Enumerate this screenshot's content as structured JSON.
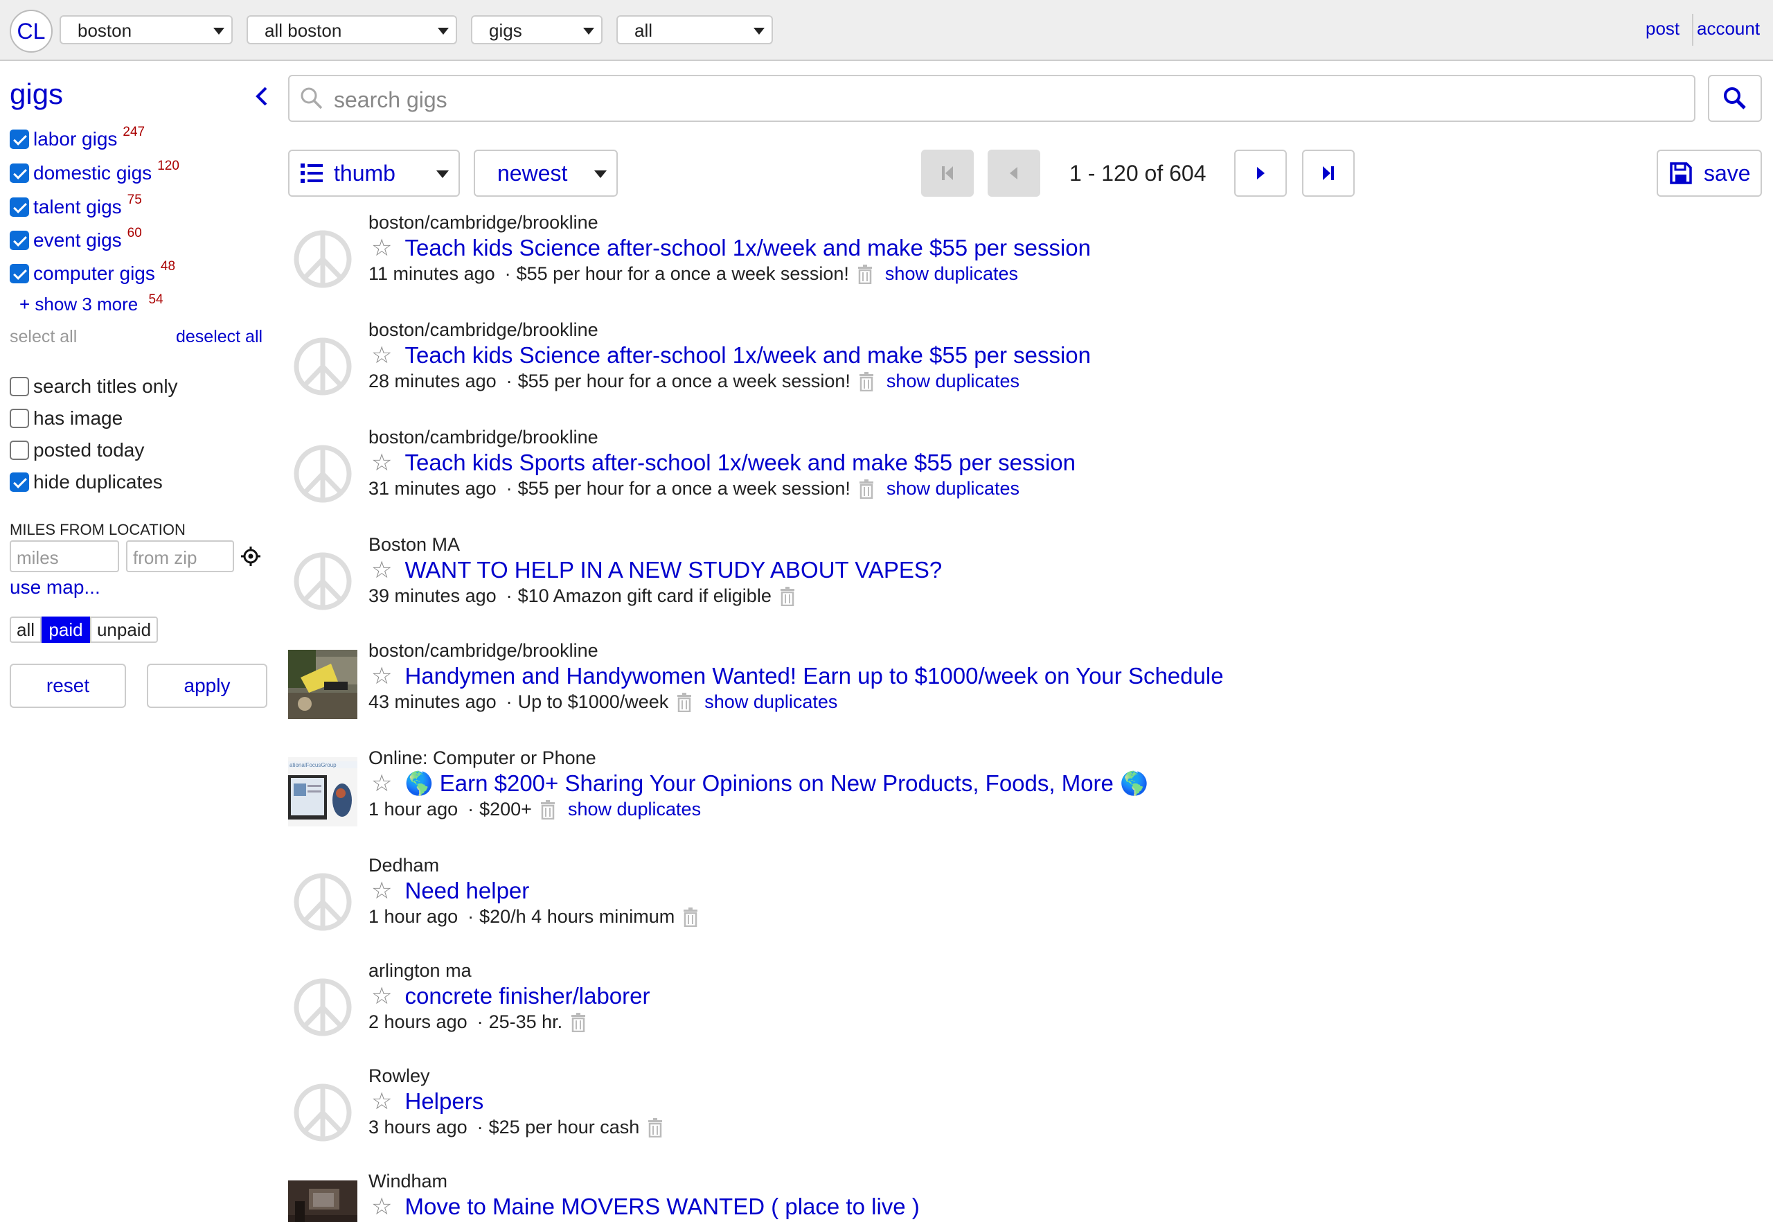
{
  "topbar": {
    "logo": "CL",
    "selects": [
      {
        "name": "site-select",
        "value": "boston"
      },
      {
        "name": "area-select",
        "value": "all boston"
      },
      {
        "name": "category-select",
        "value": "gigs"
      },
      {
        "name": "subcategory-select",
        "value": "all"
      }
    ],
    "post_label": "post",
    "account_label": "account"
  },
  "sidebar": {
    "title": "gigs",
    "categories": [
      {
        "label": "labor gigs",
        "count": "247",
        "checked": true
      },
      {
        "label": "domestic gigs",
        "count": "120",
        "checked": true
      },
      {
        "label": "talent gigs",
        "count": "75",
        "checked": true
      },
      {
        "label": "event gigs",
        "count": "60",
        "checked": true
      },
      {
        "label": "computer gigs",
        "count": "48",
        "checked": true
      }
    ],
    "show_more": {
      "label": "+  show 3 more",
      "count": "54"
    },
    "select_all": "select all",
    "deselect_all": "deselect all",
    "options": [
      {
        "label": "search titles only",
        "checked": false
      },
      {
        "label": "has image",
        "checked": false
      },
      {
        "label": "posted today",
        "checked": false
      },
      {
        "label": "hide duplicates",
        "checked": true
      }
    ],
    "miles_label": "MILES FROM LOCATION",
    "miles_placeholder": "miles",
    "zip_placeholder": "from zip",
    "use_map": "use map...",
    "pay_filter": {
      "options": [
        "all",
        "paid",
        "unpaid"
      ],
      "selected": "paid"
    },
    "reset_label": "reset",
    "apply_label": "apply"
  },
  "search": {
    "placeholder": "search gigs"
  },
  "toolbar": {
    "view_label": "thumb",
    "sort_label": "newest",
    "range": "1 - 120 of 604",
    "save_label": "save"
  },
  "results": [
    {
      "location": "boston/cambridge/brookline",
      "title": "Teach kids Science after-school 1x/week and make $55 per session",
      "time": "11 minutes ago",
      "pay": "$55 per hour for a once a week session!",
      "dupes": "show duplicates",
      "thumb": "peace"
    },
    {
      "location": "boston/cambridge/brookline",
      "title": "Teach kids Science after-school 1x/week and make $55 per session",
      "time": "28 minutes ago",
      "pay": "$55 per hour for a once a week session!",
      "dupes": "show duplicates",
      "thumb": "peace"
    },
    {
      "location": "boston/cambridge/brookline",
      "title": "Teach kids Sports after-school 1x/week and make $55 per session",
      "time": "31 minutes ago",
      "pay": "$55 per hour for a once a week session!",
      "dupes": "show duplicates",
      "thumb": "peace"
    },
    {
      "location": "Boston MA",
      "title": "WANT TO HELP IN A NEW STUDY ABOUT VAPES?",
      "time": "39 minutes ago",
      "pay": "$10 Amazon gift card if eligible",
      "dupes": "",
      "thumb": "peace"
    },
    {
      "location": "boston/cambridge/brookline",
      "title": "Handymen and Handywomen Wanted! Earn up to $1000/week on Your Schedule",
      "time": "43 minutes ago",
      "pay": "Up to $1000/week",
      "dupes": "show duplicates",
      "thumb": "photo-tools"
    },
    {
      "location": "Online: Computer or Phone",
      "title": "🌎 Earn $200+ Sharing Your Opinions on New Products, Foods, More 🌎",
      "time": "1 hour ago",
      "pay": "$200+",
      "dupes": "show duplicates",
      "thumb": "photo-focus"
    },
    {
      "location": "Dedham",
      "title": "Need helper",
      "time": "1 hour ago",
      "pay": "$20/h 4 hours minimum",
      "dupes": "",
      "thumb": "peace"
    },
    {
      "location": "arlington ma",
      "title": "concrete finisher/laborer",
      "time": "2 hours ago",
      "pay": "25-35 hr.",
      "dupes": "",
      "thumb": "peace"
    },
    {
      "location": "Rowley",
      "title": "Helpers",
      "time": "3 hours ago",
      "pay": "$25 per hour cash",
      "dupes": "",
      "thumb": "peace"
    },
    {
      "location": "Windham",
      "title": "Move to Maine MOVERS WANTED ( place to live )",
      "time": "",
      "pay": "",
      "dupes": "",
      "thumb": "photo-room"
    }
  ],
  "icons": {
    "search": "search-icon",
    "collapse": "chevron-left-icon",
    "locate": "crosshair-icon",
    "star": "star-outline-icon",
    "trash": "trash-icon",
    "list": "list-icon",
    "save": "floppy-icon"
  },
  "colors": {
    "link": "#0000cc",
    "count": "#aa0000",
    "checked": "#0a6cd9",
    "paid_active": "#0000ee",
    "topbar_bg": "#eeeeee"
  }
}
